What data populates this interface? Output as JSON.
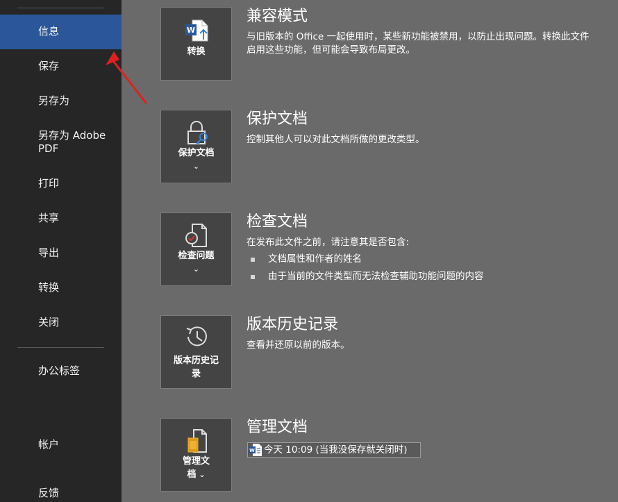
{
  "sidebar": {
    "items": [
      {
        "label": "信息"
      },
      {
        "label": "保存"
      },
      {
        "label": "另存为"
      },
      {
        "label": "另存为 Adobe"
      },
      {
        "label": "PDF"
      },
      {
        "label": "打印"
      },
      {
        "label": "共享"
      },
      {
        "label": "导出"
      },
      {
        "label": "转换"
      },
      {
        "label": "关闭"
      },
      {
        "label": "办公标签"
      },
      {
        "label": "帐户"
      },
      {
        "label": "反馈"
      }
    ]
  },
  "sections": {
    "compat": {
      "button": "转换",
      "title": "兼容模式",
      "desc1": "与旧版本的 Office 一起使用时，某些新功能被禁用，以防止出现问题。转换此文件",
      "desc2": "启用这些功能，但可能会导致布局更改。"
    },
    "protect": {
      "button": "保护文档",
      "title": "保护文档",
      "desc": "控制其他人可以对此文档所做的更改类型。"
    },
    "inspect": {
      "button": "检查问题",
      "title": "检查文档",
      "desc": "在发布此文件之前，请注意其是否包含:",
      "bullets": [
        "文档属性和作者的姓名",
        "由于当前的文件类型而无法检查辅助功能问题的内容"
      ]
    },
    "history": {
      "button1": "版本历史记",
      "button2": "录",
      "title": "版本历史记录",
      "desc": "查看并还原以前的版本。"
    },
    "manage": {
      "button1": "管理文",
      "button2": "档",
      "title": "管理文档",
      "version_entry": "今天 10:09 (当我没保存就关闭时)"
    }
  },
  "colors": {
    "sidebar_bg": "#262626",
    "selected": "#2b579a",
    "main_bg": "#6a6a6a",
    "card_bg": "#444444",
    "annotation_arrow": "#e02020"
  }
}
